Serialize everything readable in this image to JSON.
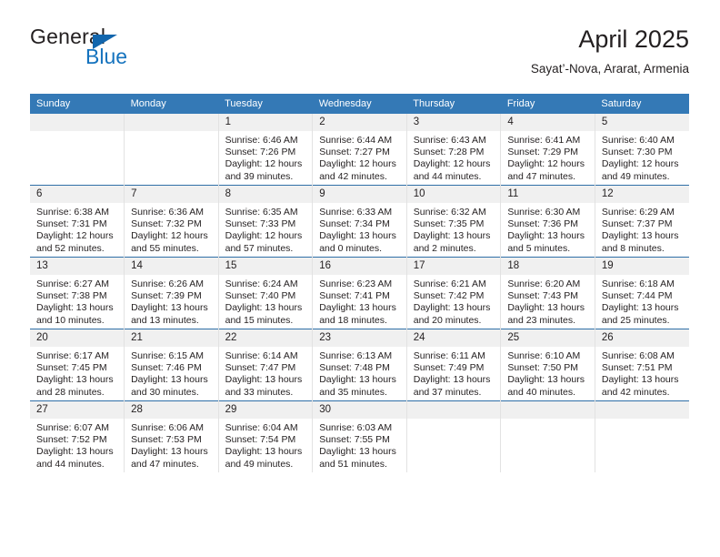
{
  "brand": {
    "name_part1": "General",
    "name_part2": "Blue",
    "flag_icon": "triangle-flag-icon"
  },
  "header": {
    "title": "April 2025",
    "subtitle": "Sayat’-Nova, Ararat, Armenia"
  },
  "colors": {
    "header_blue": "#3479b6",
    "brand_blue": "#1573be",
    "daynum_gray": "#f0f0f0",
    "row_divider": "#2f6fa7"
  },
  "weekdays": [
    "Sunday",
    "Monday",
    "Tuesday",
    "Wednesday",
    "Thursday",
    "Friday",
    "Saturday"
  ],
  "weeks": [
    [
      {
        "day": "",
        "lines": []
      },
      {
        "day": "",
        "lines": []
      },
      {
        "day": "1",
        "lines": [
          "Sunrise: 6:46 AM",
          "Sunset: 7:26 PM",
          "Daylight: 12 hours",
          "and 39 minutes."
        ]
      },
      {
        "day": "2",
        "lines": [
          "Sunrise: 6:44 AM",
          "Sunset: 7:27 PM",
          "Daylight: 12 hours",
          "and 42 minutes."
        ]
      },
      {
        "day": "3",
        "lines": [
          "Sunrise: 6:43 AM",
          "Sunset: 7:28 PM",
          "Daylight: 12 hours",
          "and 44 minutes."
        ]
      },
      {
        "day": "4",
        "lines": [
          "Sunrise: 6:41 AM",
          "Sunset: 7:29 PM",
          "Daylight: 12 hours",
          "and 47 minutes."
        ]
      },
      {
        "day": "5",
        "lines": [
          "Sunrise: 6:40 AM",
          "Sunset: 7:30 PM",
          "Daylight: 12 hours",
          "and 49 minutes."
        ]
      }
    ],
    [
      {
        "day": "6",
        "lines": [
          "Sunrise: 6:38 AM",
          "Sunset: 7:31 PM",
          "Daylight: 12 hours",
          "and 52 minutes."
        ]
      },
      {
        "day": "7",
        "lines": [
          "Sunrise: 6:36 AM",
          "Sunset: 7:32 PM",
          "Daylight: 12 hours",
          "and 55 minutes."
        ]
      },
      {
        "day": "8",
        "lines": [
          "Sunrise: 6:35 AM",
          "Sunset: 7:33 PM",
          "Daylight: 12 hours",
          "and 57 minutes."
        ]
      },
      {
        "day": "9",
        "lines": [
          "Sunrise: 6:33 AM",
          "Sunset: 7:34 PM",
          "Daylight: 13 hours",
          "and 0 minutes."
        ]
      },
      {
        "day": "10",
        "lines": [
          "Sunrise: 6:32 AM",
          "Sunset: 7:35 PM",
          "Daylight: 13 hours",
          "and 2 minutes."
        ]
      },
      {
        "day": "11",
        "lines": [
          "Sunrise: 6:30 AM",
          "Sunset: 7:36 PM",
          "Daylight: 13 hours",
          "and 5 minutes."
        ]
      },
      {
        "day": "12",
        "lines": [
          "Sunrise: 6:29 AM",
          "Sunset: 7:37 PM",
          "Daylight: 13 hours",
          "and 8 minutes."
        ]
      }
    ],
    [
      {
        "day": "13",
        "lines": [
          "Sunrise: 6:27 AM",
          "Sunset: 7:38 PM",
          "Daylight: 13 hours",
          "and 10 minutes."
        ]
      },
      {
        "day": "14",
        "lines": [
          "Sunrise: 6:26 AM",
          "Sunset: 7:39 PM",
          "Daylight: 13 hours",
          "and 13 minutes."
        ]
      },
      {
        "day": "15",
        "lines": [
          "Sunrise: 6:24 AM",
          "Sunset: 7:40 PM",
          "Daylight: 13 hours",
          "and 15 minutes."
        ]
      },
      {
        "day": "16",
        "lines": [
          "Sunrise: 6:23 AM",
          "Sunset: 7:41 PM",
          "Daylight: 13 hours",
          "and 18 minutes."
        ]
      },
      {
        "day": "17",
        "lines": [
          "Sunrise: 6:21 AM",
          "Sunset: 7:42 PM",
          "Daylight: 13 hours",
          "and 20 minutes."
        ]
      },
      {
        "day": "18",
        "lines": [
          "Sunrise: 6:20 AM",
          "Sunset: 7:43 PM",
          "Daylight: 13 hours",
          "and 23 minutes."
        ]
      },
      {
        "day": "19",
        "lines": [
          "Sunrise: 6:18 AM",
          "Sunset: 7:44 PM",
          "Daylight: 13 hours",
          "and 25 minutes."
        ]
      }
    ],
    [
      {
        "day": "20",
        "lines": [
          "Sunrise: 6:17 AM",
          "Sunset: 7:45 PM",
          "Daylight: 13 hours",
          "and 28 minutes."
        ]
      },
      {
        "day": "21",
        "lines": [
          "Sunrise: 6:15 AM",
          "Sunset: 7:46 PM",
          "Daylight: 13 hours",
          "and 30 minutes."
        ]
      },
      {
        "day": "22",
        "lines": [
          "Sunrise: 6:14 AM",
          "Sunset: 7:47 PM",
          "Daylight: 13 hours",
          "and 33 minutes."
        ]
      },
      {
        "day": "23",
        "lines": [
          "Sunrise: 6:13 AM",
          "Sunset: 7:48 PM",
          "Daylight: 13 hours",
          "and 35 minutes."
        ]
      },
      {
        "day": "24",
        "lines": [
          "Sunrise: 6:11 AM",
          "Sunset: 7:49 PM",
          "Daylight: 13 hours",
          "and 37 minutes."
        ]
      },
      {
        "day": "25",
        "lines": [
          "Sunrise: 6:10 AM",
          "Sunset: 7:50 PM",
          "Daylight: 13 hours",
          "and 40 minutes."
        ]
      },
      {
        "day": "26",
        "lines": [
          "Sunrise: 6:08 AM",
          "Sunset: 7:51 PM",
          "Daylight: 13 hours",
          "and 42 minutes."
        ]
      }
    ],
    [
      {
        "day": "27",
        "lines": [
          "Sunrise: 6:07 AM",
          "Sunset: 7:52 PM",
          "Daylight: 13 hours",
          "and 44 minutes."
        ]
      },
      {
        "day": "28",
        "lines": [
          "Sunrise: 6:06 AM",
          "Sunset: 7:53 PM",
          "Daylight: 13 hours",
          "and 47 minutes."
        ]
      },
      {
        "day": "29",
        "lines": [
          "Sunrise: 6:04 AM",
          "Sunset: 7:54 PM",
          "Daylight: 13 hours",
          "and 49 minutes."
        ]
      },
      {
        "day": "30",
        "lines": [
          "Sunrise: 6:03 AM",
          "Sunset: 7:55 PM",
          "Daylight: 13 hours",
          "and 51 minutes."
        ]
      },
      {
        "day": "",
        "lines": []
      },
      {
        "day": "",
        "lines": []
      },
      {
        "day": "",
        "lines": []
      }
    ]
  ]
}
